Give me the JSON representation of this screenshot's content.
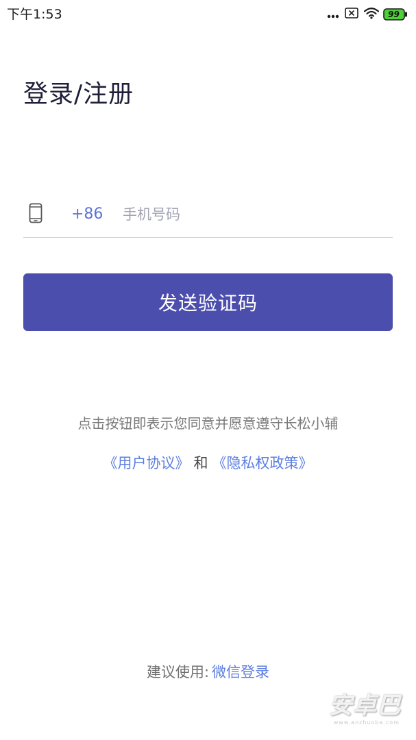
{
  "status_bar": {
    "time": "下午1:53",
    "battery": "99",
    "battery_color": "#4cd137"
  },
  "title": "登录/注册",
  "phone": {
    "icon": "mobile-phone-icon",
    "country_code": "+86",
    "placeholder": "手机号码",
    "value": ""
  },
  "send_button_label": "发送验证码",
  "agreement": {
    "text": "点击按钮即表示您同意并愿意遵守长松小辅",
    "user_agreement": "《用户协议》",
    "conjunction": "和",
    "privacy_policy": "《隐私权政策》"
  },
  "footer": {
    "label": "建议使用:",
    "wechat_login": "微信登录"
  },
  "watermark": {
    "text": "安卓巴",
    "sub": "www.anzhuoba.com"
  },
  "colors": {
    "accent": "#4c4ead",
    "link": "#5c7ee0",
    "country_code": "#5d73d6",
    "title": "#1f1f3a"
  }
}
